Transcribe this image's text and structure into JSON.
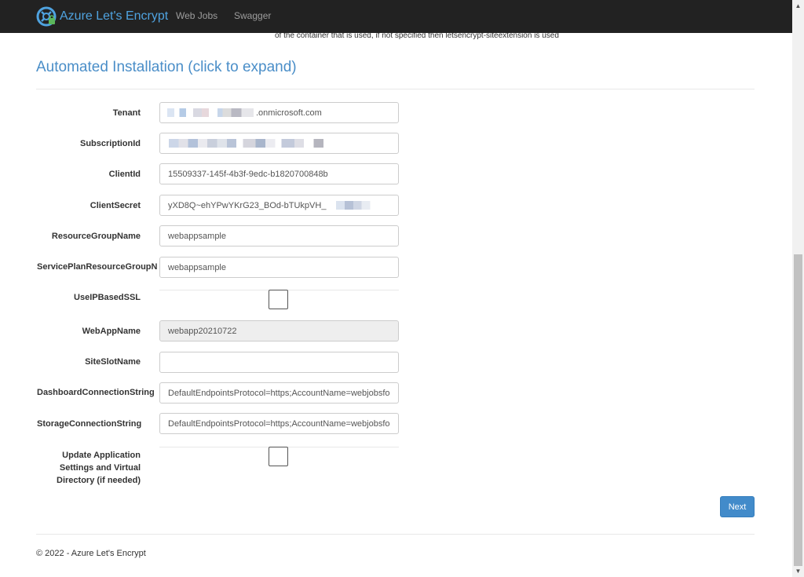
{
  "navbar": {
    "brand": "Azure Let's Encrypt",
    "links": [
      "Web Jobs",
      "Swagger"
    ]
  },
  "intro_cut_text": "of the container that is used, if not specified then letsencrypt-siteextension is used",
  "section_title": "Automated Installation (click to expand)",
  "form": {
    "tenant": {
      "label": "Tenant",
      "value": ".onmicrosoft.com"
    },
    "subscription": {
      "label": "SubscriptionId",
      "value": ""
    },
    "client_id": {
      "label": "ClientId",
      "value": "15509337-145f-4b3f-9edc-b1820700848b"
    },
    "client_secret": {
      "label": "ClientSecret",
      "value": "yXD8Q~ehYPwYKrG23_BOd-bTUkpVH_"
    },
    "resource_group": {
      "label": "ResourceGroupName",
      "value": "webappsample"
    },
    "service_plan_rg": {
      "label": "ServicePlanResourceGroupN",
      "value": "webappsample"
    },
    "use_ip_ssl": {
      "label": "UseIPBasedSSL",
      "checked": false
    },
    "webapp_name": {
      "label": "WebAppName",
      "value": "webapp20210722"
    },
    "site_slot": {
      "label": "SiteSlotName",
      "value": ""
    },
    "dashboard_conn": {
      "label": "DashboardConnectionString",
      "value": "DefaultEndpointsProtocol=https;AccountName=webjobsfo"
    },
    "storage_conn": {
      "label": "StorageConnectionString",
      "value": "DefaultEndpointsProtocol=https;AccountName=webjobsfo"
    },
    "update_settings": {
      "label": "Update Application Settings and Virtual Directory (if needed)",
      "checked": false
    }
  },
  "next_label": "Next",
  "footer": "© 2022 - Azure Let's Encrypt",
  "colors": {
    "navbar": "#222222",
    "brand": "#4fa3e0",
    "title": "#4a8ec8",
    "button": "#428bca"
  }
}
